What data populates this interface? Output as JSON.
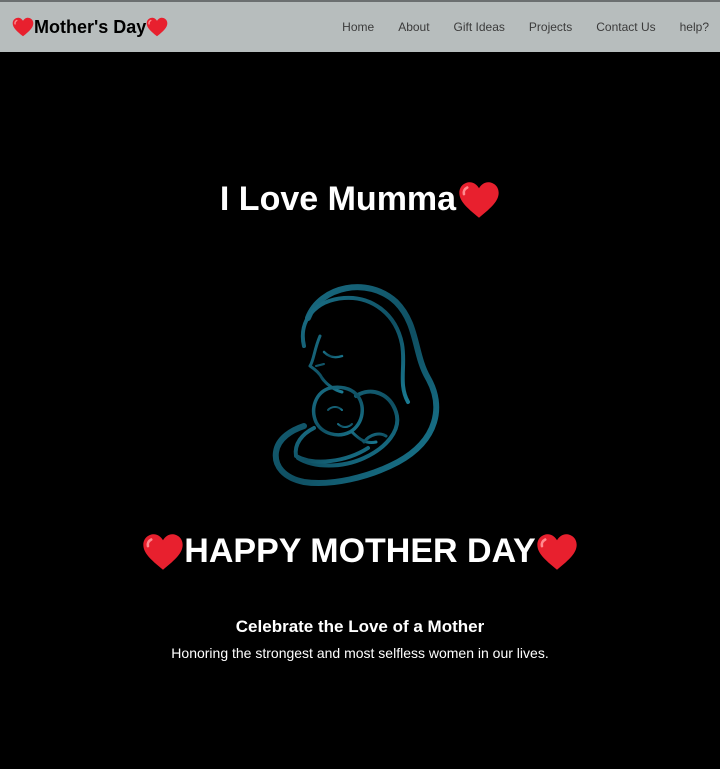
{
  "navbar": {
    "brand_text": "Mother's Day",
    "links": [
      "Home",
      "About",
      "Gift Ideas",
      "Projects",
      "Contact Us",
      "help?"
    ]
  },
  "main": {
    "title": "I Love Mumma",
    "banner": "HAPPY MOTHER DAY",
    "subheading": "Celebrate the Love of a Mother",
    "tagline": "Honoring the strongest and most selfless women in our lives."
  },
  "icons": {
    "heart": "heart-icon",
    "illustration": "mother-and-child-illustration"
  },
  "colors": {
    "navbar_bg": "#b7bdbd",
    "page_bg": "#000000",
    "heart": "#e8202e",
    "illustration": "#1a6f86"
  }
}
